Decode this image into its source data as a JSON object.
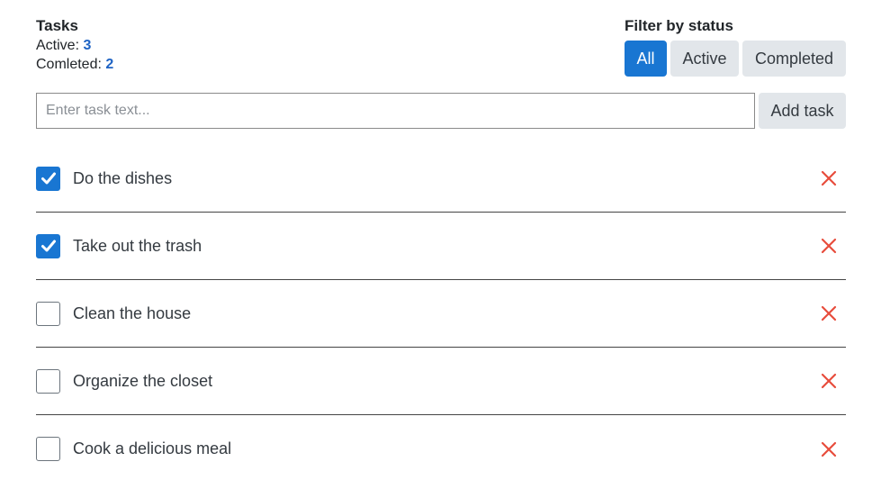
{
  "stats": {
    "title": "Tasks",
    "active_label": "Active:",
    "active_count": "3",
    "completed_label": "Comleted:",
    "completed_count": "2"
  },
  "filter": {
    "title": "Filter by status",
    "options": [
      {
        "label": "All",
        "selected": true
      },
      {
        "label": "Active",
        "selected": false
      },
      {
        "label": "Completed",
        "selected": false
      }
    ]
  },
  "new_task": {
    "placeholder": "Enter task text...",
    "value": "",
    "add_label": "Add task"
  },
  "tasks": [
    {
      "text": "Do the dishes",
      "completed": true
    },
    {
      "text": "Take out the trash",
      "completed": true
    },
    {
      "text": "Clean the house",
      "completed": false
    },
    {
      "text": "Organize the closet",
      "completed": false
    },
    {
      "text": "Cook a delicious meal",
      "completed": false
    }
  ],
  "icons": {
    "checkbox_checked": "check-icon",
    "delete": "close-icon"
  },
  "colors": {
    "accent": "#1976d2",
    "count": "#1e63c4",
    "delete": "#e74c3c",
    "button_bg": "#e2e6ea"
  }
}
